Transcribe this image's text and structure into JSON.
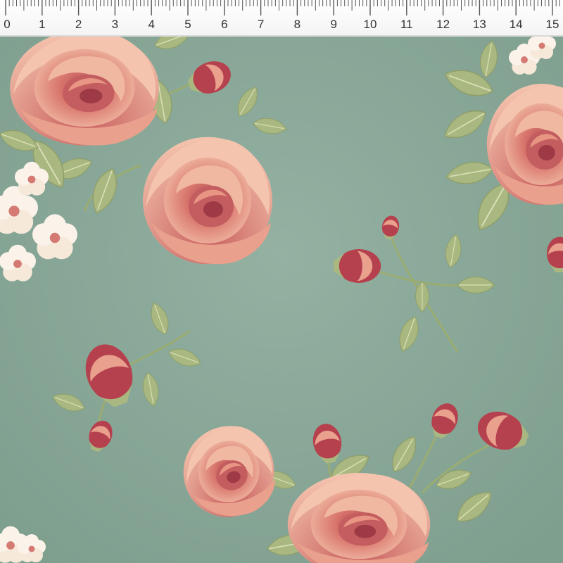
{
  "ruler": {
    "labels": [
      "0",
      "1",
      "2",
      "3",
      "4",
      "5",
      "6",
      "7",
      "8",
      "9",
      "10",
      "11",
      "12",
      "13",
      "14",
      "15"
    ],
    "tick_color": "#555555"
  },
  "fabric": {
    "background_color": "#8aa898",
    "rose_colors": [
      "#e9a08c",
      "#c9605f",
      "#f4c4ae"
    ],
    "bud_color": "#b5414e",
    "leaf_colors": [
      "#a9b880",
      "#c7cf9f"
    ],
    "blossom_color": "#fbf3ea",
    "blossom_center": "#d47a73"
  }
}
